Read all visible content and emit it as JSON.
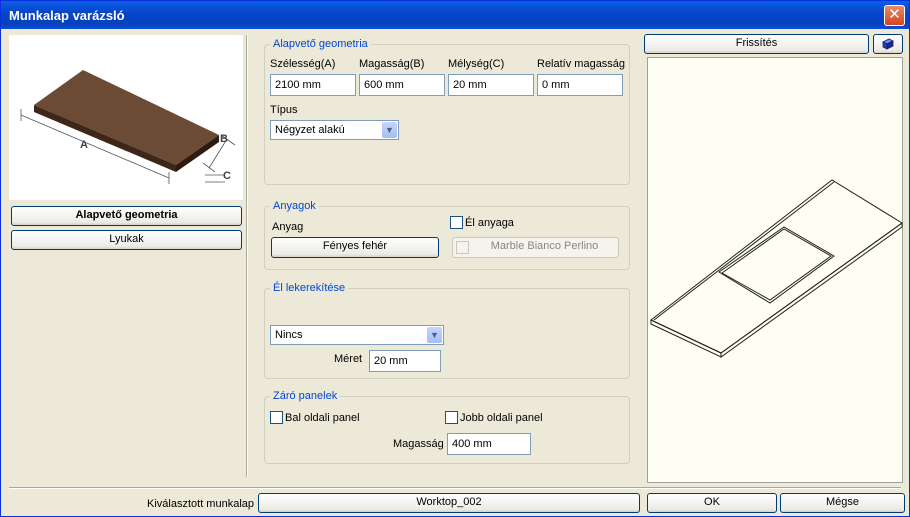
{
  "window": {
    "title": "Munkalap varázsló"
  },
  "left": {
    "btn_geometry": "Alapvető geometria",
    "btn_holes": "Lyukak",
    "dim_a": "A",
    "dim_b": "B",
    "dim_c": "C"
  },
  "geometry": {
    "group_title": "Alapvető geometria",
    "width_label": "Szélesség(A)",
    "width_value": "2100 mm",
    "height_label": "Magasság(B)",
    "height_value": "600 mm",
    "depth_label": "Mélység(C)",
    "depth_value": "20 mm",
    "relheight_label": "Relatív magasság",
    "relheight_value": "0 mm",
    "type_label": "Típus",
    "type_value": "Négyzet alakú"
  },
  "materials": {
    "group_title": "Anyagok",
    "material_label": "Anyag",
    "material_value": "Fényes fehér",
    "edge_material_label": "Él anyaga",
    "edge_material_value": "Marble Bianco Perlino"
  },
  "edge_rounding": {
    "group_title": "Él lekerekítése",
    "value": "Nincs",
    "size_label": "Méret",
    "size_value": "20 mm"
  },
  "end_panels": {
    "group_title": "Záró panelek",
    "left_label": "Bal oldali panel",
    "right_label": "Jobb oldali panel",
    "height_label": "Magasság",
    "height_value": "400 mm"
  },
  "view": {
    "refresh_label": "Frissítés"
  },
  "footer": {
    "selected_label": "Kiválasztott munkalap",
    "selected_value": "Worktop_002",
    "ok_label": "OK",
    "cancel_label": "Mégse"
  },
  "colors": {
    "titlebar": "#0846c9",
    "group_title": "#0046d5",
    "board": "#5e3f2d",
    "window_bg": "#ece9d8"
  }
}
